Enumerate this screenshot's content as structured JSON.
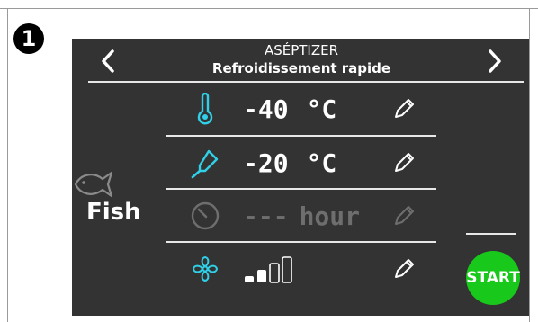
{
  "step_number": "1",
  "header": {
    "title": "ASÉPTIZER",
    "subtitle": "Refroidissement rapide",
    "prev_icon": "chevron-left",
    "next_icon": "chevron-right"
  },
  "product": {
    "label": "Fish",
    "icon": "fish-icon"
  },
  "rows": [
    {
      "icon": "thermometer-icon",
      "value": "-40",
      "unit": "°C",
      "active": true
    },
    {
      "icon": "probe-icon",
      "value": "-20",
      "unit": "°C",
      "active": true
    },
    {
      "icon": "clock-icon",
      "value": "---",
      "unit": "hour",
      "active": false
    },
    {
      "icon": "fan-icon",
      "fan_level": 2,
      "fan_max": 4,
      "active": true
    }
  ],
  "start_label": "START",
  "colors": {
    "screen_bg": "#333333",
    "accent_cyan": "#2fd0e8",
    "start_green": "#18c81a",
    "disabled": "#6e6e6e"
  }
}
